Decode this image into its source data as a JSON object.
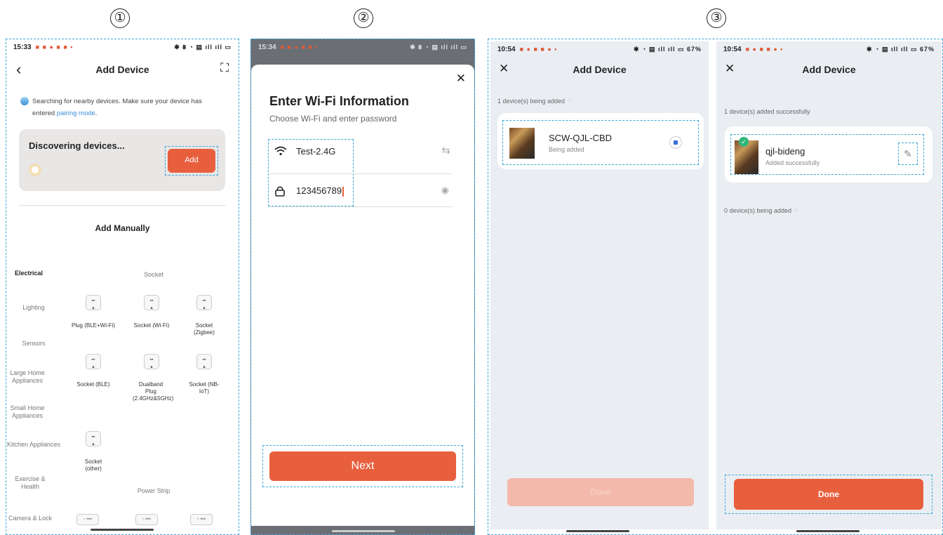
{
  "steps": [
    "①",
    "②",
    "③"
  ],
  "status": {
    "s1_time": "15:33",
    "s2_time": "15:34",
    "s3_time": "10:54",
    "s4_time": "10:54",
    "s1_icons": "✱ ⩩ ◔ ▤ ıll ıll ▭",
    "s2_icons": "✱ ⩩ ◔ ▤ ıll ıll ▭",
    "s3_icons": "✱ ◔ ▤ ıll ıll ▭ 67%",
    "s4_icons": "✱ ◔ ▤ ıll ıll ▭ 67%"
  },
  "screen1": {
    "title": "Add Device",
    "back_icon": "‹",
    "scan_icon": "⛶",
    "search_text_1": "Searching for nearby devices. Make sure your device has entered ",
    "search_link": "pairing mode",
    "search_text_2": ".",
    "discovering": "Discovering devices...",
    "add_button": "Add",
    "add_manually": "Add Manually",
    "categories": [
      "Electrical",
      "Lighting",
      "Sensors",
      "Large Home Appliances",
      "Small Home Appliances",
      "Kitchen Appliances",
      "Exercise & Health",
      "Camera & Lock"
    ],
    "section_socket": "Socket",
    "section_power_strip": "Power Strip",
    "devices": [
      "Plug (BLE+Wi-Fi)",
      "Socket (Wi-Fi)",
      "Socket (Zigbee)",
      "Socket (BLE)",
      "Dualband Plug (2.4GHz&5GHz)",
      "Socket (NB-IoT)",
      "Socket (other)"
    ]
  },
  "screen2": {
    "close_icon": "✕",
    "title": "Enter Wi-Fi Information",
    "subtitle": "Choose Wi-Fi and enter password",
    "wifi_name": "Test-2.4G",
    "password": "123456789",
    "wifi_icon": "wifi-icon",
    "swap_icon": "⇆",
    "lock_icon": "lock-icon",
    "eye_icon": "◉",
    "next_button": "Next"
  },
  "screen3": {
    "close_icon": "✕",
    "title": "Add Device",
    "status_line": "1 device(s) being added",
    "device_name": "SCW-QJL-CBD",
    "device_status": "Being added",
    "done_button": "Done"
  },
  "screen4": {
    "close_icon": "✕",
    "title": "Add Device",
    "success_line": "1 device(s) added successfully",
    "device_name": "qjl-bideng",
    "device_status": "Added successfully",
    "pending_line": "0 device(s) being added",
    "edit_icon": "✎",
    "done_button": "Done"
  },
  "colors": {
    "accent": "#e85f3e",
    "link": "#3b8fd9",
    "highlight": "#3aa9d8",
    "panel_bg": "#eaeef3"
  }
}
